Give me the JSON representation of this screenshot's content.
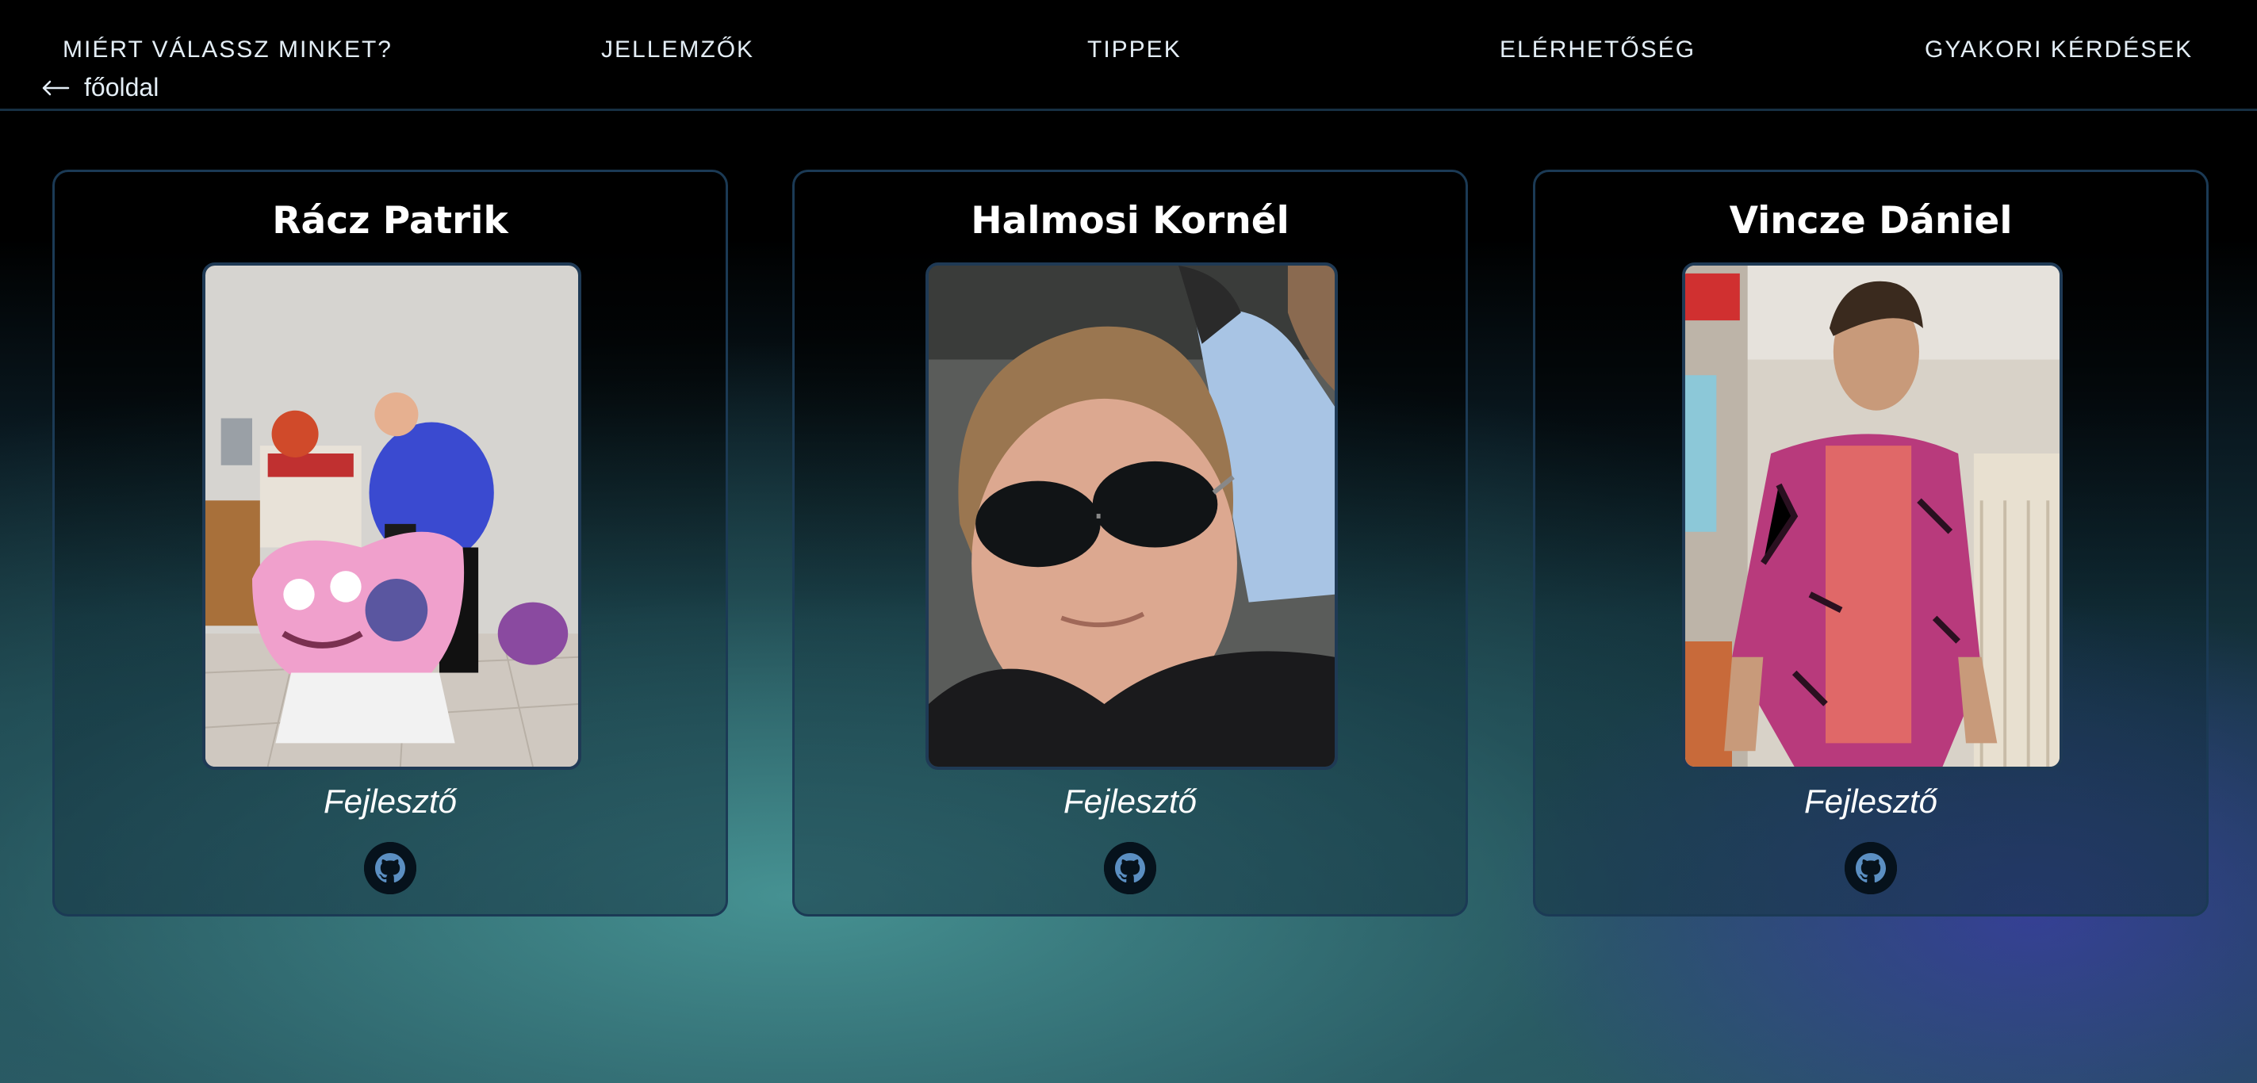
{
  "nav": {
    "items": [
      {
        "label": "MIÉRT VÁLASSZ MINKET?"
      },
      {
        "label": "JELLEMZŐK"
      },
      {
        "label": "TIPPEK"
      },
      {
        "label": "ELÉRHETŐSÉG"
      },
      {
        "label": "GYAKORI KÉRDÉSEK"
      }
    ],
    "home": {
      "label": "főoldal",
      "icon": "arrow-left-icon"
    }
  },
  "team": [
    {
      "name": "Rácz Patrik",
      "role": "Fejlesztő",
      "icon": "github-icon"
    },
    {
      "name": "Halmosi Kornél",
      "role": "Fejlesztő",
      "icon": "github-icon"
    },
    {
      "name": "Vincze Dániel",
      "role": "Fejlesztő",
      "icon": "github-icon"
    }
  ],
  "colors": {
    "card_border": "#1b3a55",
    "header_bg": "#000000",
    "accent_teal": "#489696",
    "accent_indigo": "#3c3caa"
  }
}
